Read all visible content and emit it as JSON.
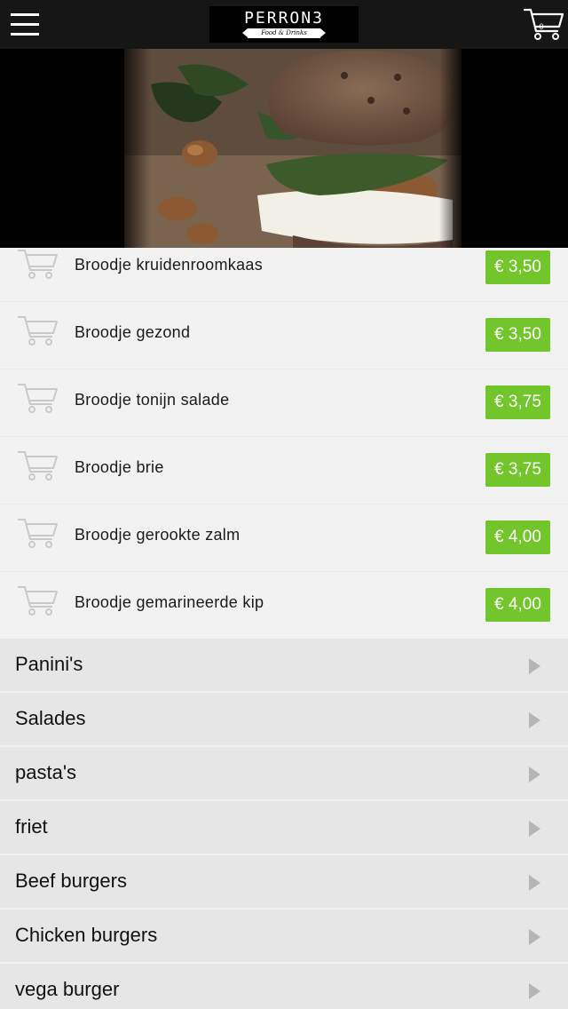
{
  "header": {
    "menu_icon": "hamburger-menu-icon",
    "logo_name": "PERRON3",
    "logo_tagline": "Food & Drinks",
    "cart_icon": "shopping-cart-icon",
    "cart_count": "0"
  },
  "hero": {
    "image": "sandwich-photo"
  },
  "products": [
    {
      "name": "Broodje kruidenroomkaas",
      "price": "€ 3,50"
    },
    {
      "name": "Broodje gezond",
      "price": "€ 3,50"
    },
    {
      "name": "Broodje tonijn salade",
      "price": "€ 3,75"
    },
    {
      "name": "Broodje brie",
      "price": "€ 3,75"
    },
    {
      "name": "Broodje gerookte zalm",
      "price": "€ 4,00"
    },
    {
      "name": "Broodje gemarineerde kip",
      "price": "€ 4,00"
    }
  ],
  "categories": [
    {
      "label": "Panini's"
    },
    {
      "label": "Salades"
    },
    {
      "label": "pasta's"
    },
    {
      "label": "friet"
    },
    {
      "label": "Beef burgers"
    },
    {
      "label": "Chicken burgers"
    },
    {
      "label": "vega burger"
    }
  ],
  "colors": {
    "header_bg": "#161616",
    "price_badge": "#73c52c",
    "product_row_bg": "#f2f2f2",
    "category_row_bg": "#e6e6e6"
  }
}
